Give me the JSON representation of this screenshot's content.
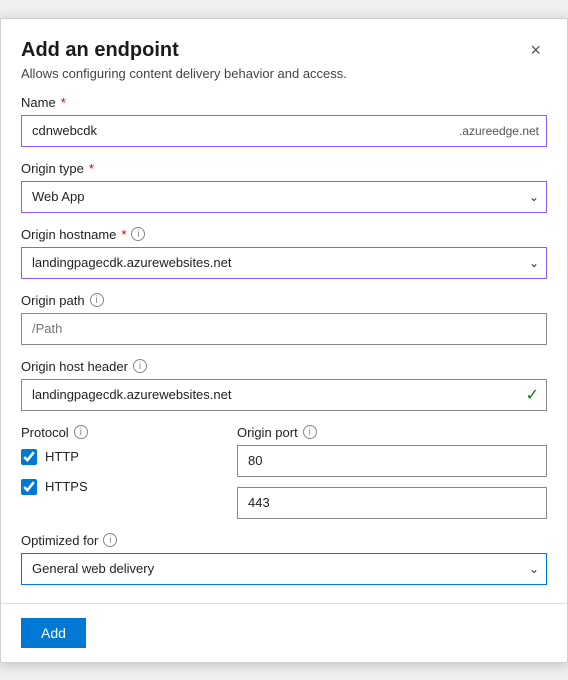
{
  "dialog": {
    "title": "Add an endpoint",
    "subtitle": "Allows configuring content delivery behavior and access.",
    "close_label": "×"
  },
  "form": {
    "name_label": "Name",
    "name_value": "cdnwebcdk",
    "name_suffix": ".azureedge.net",
    "origin_type_label": "Origin type",
    "origin_type_value": "Web App",
    "origin_hostname_label": "Origin hostname",
    "origin_hostname_value": "landingpagecdk.azurewebsites.net",
    "origin_path_label": "Origin path",
    "origin_path_placeholder": "/Path",
    "origin_host_header_label": "Origin host header",
    "origin_host_header_value": "landingpagecdk.azurewebsites.net",
    "protocol_label": "Protocol",
    "http_label": "HTTP",
    "https_label": "HTTPS",
    "http_checked": true,
    "https_checked": true,
    "origin_port_label": "Origin port",
    "http_port_value": "80",
    "https_port_value": "443",
    "optimized_for_label": "Optimized for",
    "optimized_for_value": "General web delivery",
    "add_button_label": "Add"
  }
}
